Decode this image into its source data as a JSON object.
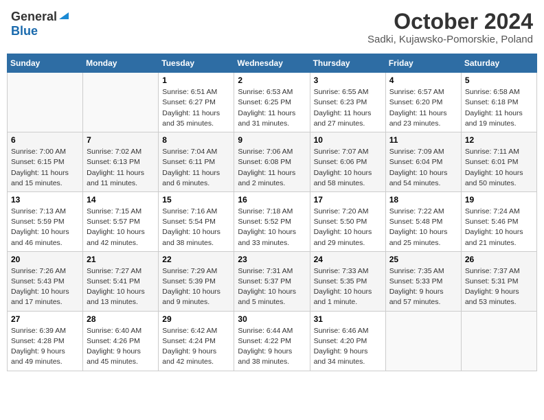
{
  "header": {
    "logo_general": "General",
    "logo_blue": "Blue",
    "month": "October 2024",
    "location": "Sadki, Kujawsko-Pomorskie, Poland"
  },
  "weekdays": [
    "Sunday",
    "Monday",
    "Tuesday",
    "Wednesday",
    "Thursday",
    "Friday",
    "Saturday"
  ],
  "weeks": [
    [
      {
        "day": "",
        "info": ""
      },
      {
        "day": "",
        "info": ""
      },
      {
        "day": "1",
        "info": "Sunrise: 6:51 AM\nSunset: 6:27 PM\nDaylight: 11 hours and 35 minutes."
      },
      {
        "day": "2",
        "info": "Sunrise: 6:53 AM\nSunset: 6:25 PM\nDaylight: 11 hours and 31 minutes."
      },
      {
        "day": "3",
        "info": "Sunrise: 6:55 AM\nSunset: 6:23 PM\nDaylight: 11 hours and 27 minutes."
      },
      {
        "day": "4",
        "info": "Sunrise: 6:57 AM\nSunset: 6:20 PM\nDaylight: 11 hours and 23 minutes."
      },
      {
        "day": "5",
        "info": "Sunrise: 6:58 AM\nSunset: 6:18 PM\nDaylight: 11 hours and 19 minutes."
      }
    ],
    [
      {
        "day": "6",
        "info": "Sunrise: 7:00 AM\nSunset: 6:15 PM\nDaylight: 11 hours and 15 minutes."
      },
      {
        "day": "7",
        "info": "Sunrise: 7:02 AM\nSunset: 6:13 PM\nDaylight: 11 hours and 11 minutes."
      },
      {
        "day": "8",
        "info": "Sunrise: 7:04 AM\nSunset: 6:11 PM\nDaylight: 11 hours and 6 minutes."
      },
      {
        "day": "9",
        "info": "Sunrise: 7:06 AM\nSunset: 6:08 PM\nDaylight: 11 hours and 2 minutes."
      },
      {
        "day": "10",
        "info": "Sunrise: 7:07 AM\nSunset: 6:06 PM\nDaylight: 10 hours and 58 minutes."
      },
      {
        "day": "11",
        "info": "Sunrise: 7:09 AM\nSunset: 6:04 PM\nDaylight: 10 hours and 54 minutes."
      },
      {
        "day": "12",
        "info": "Sunrise: 7:11 AM\nSunset: 6:01 PM\nDaylight: 10 hours and 50 minutes."
      }
    ],
    [
      {
        "day": "13",
        "info": "Sunrise: 7:13 AM\nSunset: 5:59 PM\nDaylight: 10 hours and 46 minutes."
      },
      {
        "day": "14",
        "info": "Sunrise: 7:15 AM\nSunset: 5:57 PM\nDaylight: 10 hours and 42 minutes."
      },
      {
        "day": "15",
        "info": "Sunrise: 7:16 AM\nSunset: 5:54 PM\nDaylight: 10 hours and 38 minutes."
      },
      {
        "day": "16",
        "info": "Sunrise: 7:18 AM\nSunset: 5:52 PM\nDaylight: 10 hours and 33 minutes."
      },
      {
        "day": "17",
        "info": "Sunrise: 7:20 AM\nSunset: 5:50 PM\nDaylight: 10 hours and 29 minutes."
      },
      {
        "day": "18",
        "info": "Sunrise: 7:22 AM\nSunset: 5:48 PM\nDaylight: 10 hours and 25 minutes."
      },
      {
        "day": "19",
        "info": "Sunrise: 7:24 AM\nSunset: 5:46 PM\nDaylight: 10 hours and 21 minutes."
      }
    ],
    [
      {
        "day": "20",
        "info": "Sunrise: 7:26 AM\nSunset: 5:43 PM\nDaylight: 10 hours and 17 minutes."
      },
      {
        "day": "21",
        "info": "Sunrise: 7:27 AM\nSunset: 5:41 PM\nDaylight: 10 hours and 13 minutes."
      },
      {
        "day": "22",
        "info": "Sunrise: 7:29 AM\nSunset: 5:39 PM\nDaylight: 10 hours and 9 minutes."
      },
      {
        "day": "23",
        "info": "Sunrise: 7:31 AM\nSunset: 5:37 PM\nDaylight: 10 hours and 5 minutes."
      },
      {
        "day": "24",
        "info": "Sunrise: 7:33 AM\nSunset: 5:35 PM\nDaylight: 10 hours and 1 minute."
      },
      {
        "day": "25",
        "info": "Sunrise: 7:35 AM\nSunset: 5:33 PM\nDaylight: 9 hours and 57 minutes."
      },
      {
        "day": "26",
        "info": "Sunrise: 7:37 AM\nSunset: 5:31 PM\nDaylight: 9 hours and 53 minutes."
      }
    ],
    [
      {
        "day": "27",
        "info": "Sunrise: 6:39 AM\nSunset: 4:28 PM\nDaylight: 9 hours and 49 minutes."
      },
      {
        "day": "28",
        "info": "Sunrise: 6:40 AM\nSunset: 4:26 PM\nDaylight: 9 hours and 45 minutes."
      },
      {
        "day": "29",
        "info": "Sunrise: 6:42 AM\nSunset: 4:24 PM\nDaylight: 9 hours and 42 minutes."
      },
      {
        "day": "30",
        "info": "Sunrise: 6:44 AM\nSunset: 4:22 PM\nDaylight: 9 hours and 38 minutes."
      },
      {
        "day": "31",
        "info": "Sunrise: 6:46 AM\nSunset: 4:20 PM\nDaylight: 9 hours and 34 minutes."
      },
      {
        "day": "",
        "info": ""
      },
      {
        "day": "",
        "info": ""
      }
    ]
  ]
}
